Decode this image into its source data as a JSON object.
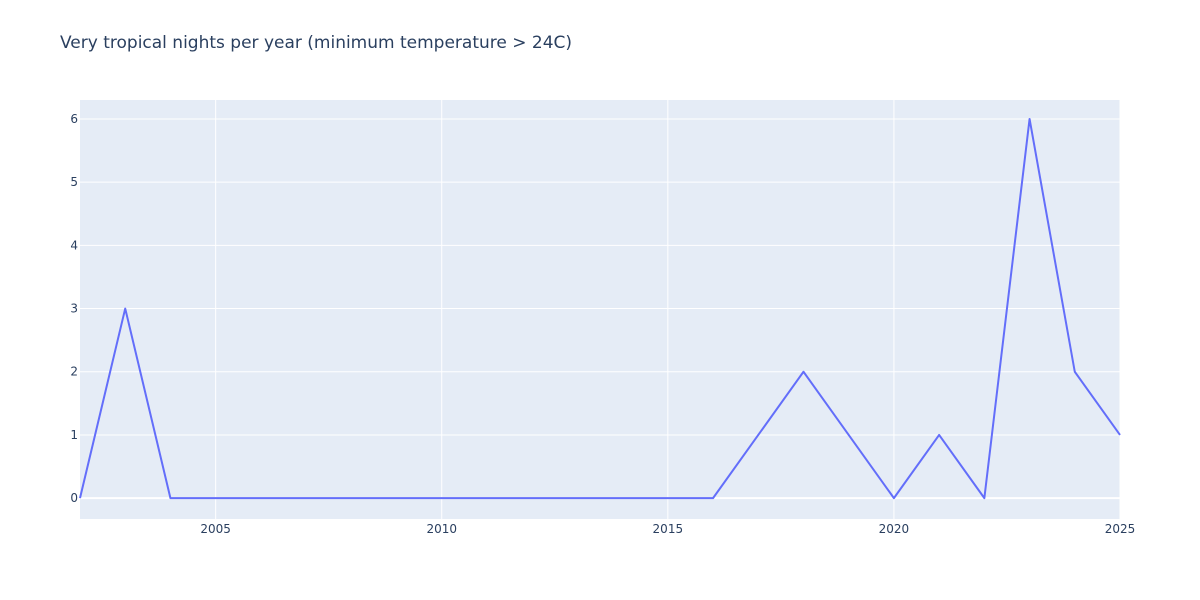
{
  "chart_data": {
    "type": "line",
    "title": "Very tropical nights per year (minimum temperature > 24C)",
    "xlabel": "",
    "ylabel": "",
    "xlim": [
      2002,
      2025
    ],
    "ylim": [
      -0.33,
      6.3
    ],
    "x_ticks": [
      2005,
      2010,
      2015,
      2020,
      2025
    ],
    "y_ticks": [
      0,
      1,
      2,
      3,
      4,
      5,
      6
    ],
    "grid": true,
    "legend": "none",
    "colors": {
      "line": "#636efa",
      "plot_bg": "#e5ecf6",
      "grid": "#ffffff",
      "text": "#2a3f5f"
    },
    "series": [
      {
        "x": [
          2002,
          2003,
          2004,
          2005,
          2006,
          2007,
          2008,
          2009,
          2010,
          2011,
          2012,
          2013,
          2014,
          2015,
          2016,
          2017,
          2018,
          2019,
          2020,
          2021,
          2022,
          2023,
          2024,
          2025
        ],
        "y": [
          0,
          3,
          0,
          0,
          0,
          0,
          0,
          0,
          0,
          0,
          0,
          0,
          0,
          0,
          0,
          1,
          2,
          1,
          0,
          1,
          0,
          6,
          2,
          1
        ]
      }
    ]
  }
}
